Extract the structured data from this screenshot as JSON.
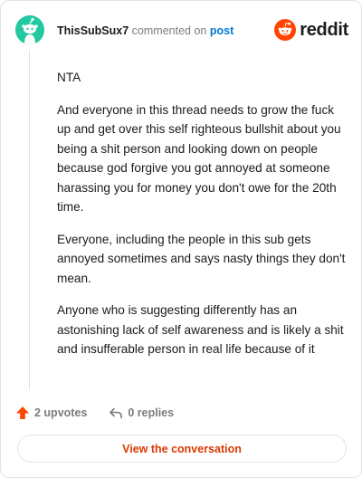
{
  "comment": {
    "author": "ThisSubSux7",
    "action": "commented on",
    "target_link": "post",
    "body": [
      "NTA",
      "And everyone in this thread needs to grow the fuck up and get over this self righteous bullshit about you being a shit person and looking down on people because god forgive you got annoyed at someone harassing you for money you don't owe for the 20th time.",
      "Everyone, including the people in this sub gets annoyed sometimes and says nasty things they don't mean.",
      "Anyone who is suggesting differently has an astonishing lack of self awareness and is likely a shit and insufferable person in real life because of it"
    ]
  },
  "brand": {
    "name": "reddit",
    "icon": "reddit-logo-icon",
    "color": "#ff4500"
  },
  "avatar": {
    "icon": "snoo-avatar-icon",
    "color": "#22c9a0"
  },
  "footer": {
    "upvotes_label": "2 upvotes",
    "upvote_icon": "upvote-arrow-icon",
    "upvote_color": "#ff4500",
    "replies_label": "0 replies",
    "reply_icon": "reply-arrow-icon"
  },
  "cta": {
    "label": "View the conversation",
    "color": "#d93a00"
  }
}
